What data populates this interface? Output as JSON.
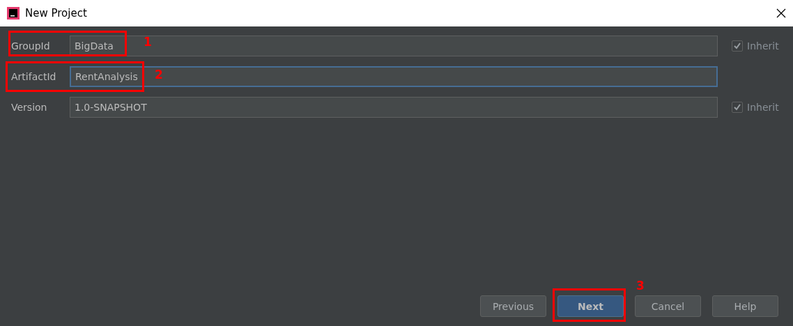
{
  "window": {
    "title": "New Project"
  },
  "fields": [
    {
      "label": "GroupId",
      "value": "BigData",
      "focused": false,
      "inherit": {
        "label": "Inherit",
        "checked": true
      }
    },
    {
      "label": "ArtifactId",
      "value": "RentAnalysis",
      "focused": true
    },
    {
      "label": "Version",
      "value": "1.0-SNAPSHOT",
      "focused": false,
      "inherit": {
        "label": "Inherit",
        "checked": true
      }
    }
  ],
  "buttons": [
    {
      "label": "Previous",
      "default": false
    },
    {
      "label": "Next",
      "default": true
    },
    {
      "label": "Cancel",
      "default": false
    },
    {
      "label": "Help",
      "default": false
    }
  ],
  "annotations": [
    "1",
    "2",
    "3"
  ]
}
